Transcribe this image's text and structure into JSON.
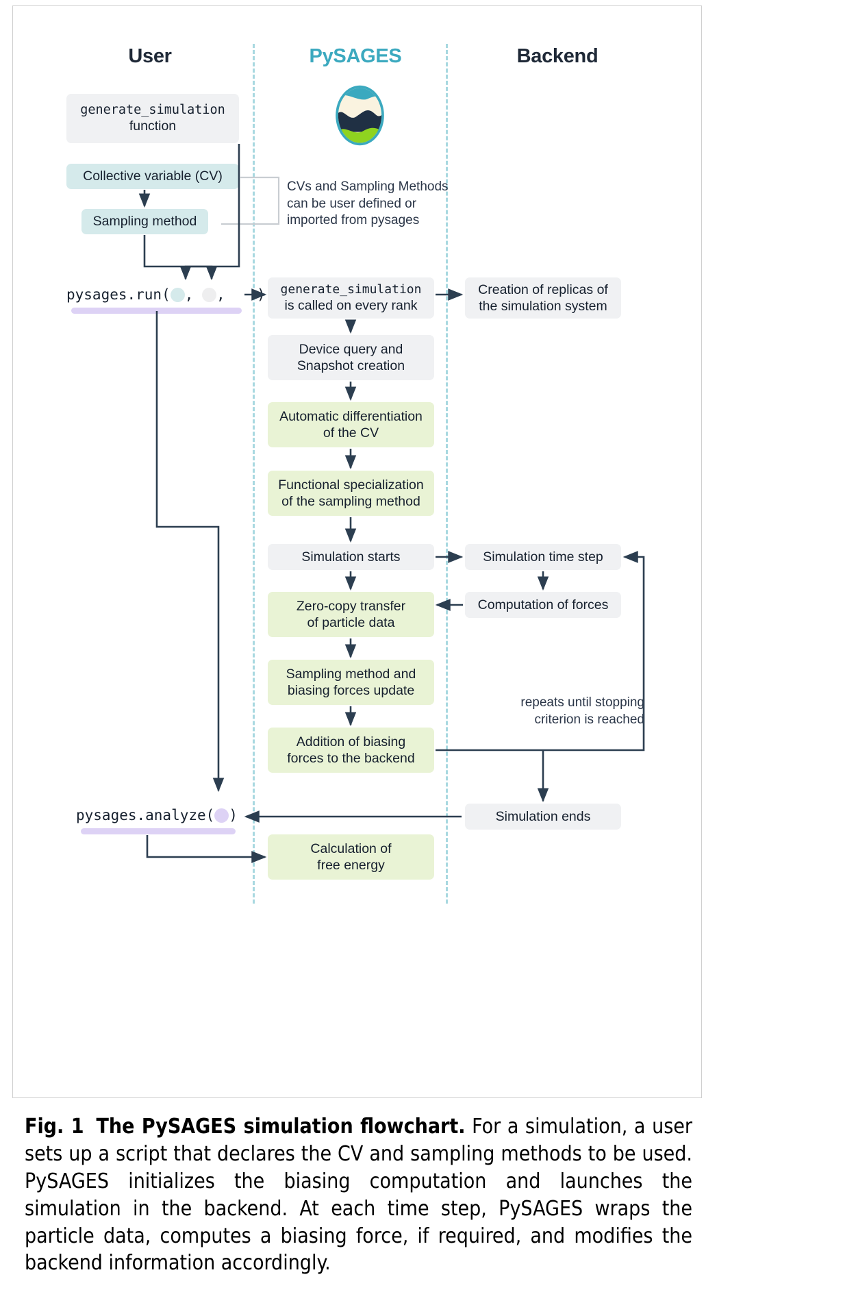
{
  "figure": {
    "columns": [
      {
        "id": "user",
        "label": "User"
      },
      {
        "id": "pysages",
        "label": "PySAGES"
      },
      {
        "id": "backend",
        "label": "Backend"
      }
    ],
    "logo": {
      "name": "pysages-logo",
      "ring_color": "#3ba9bf",
      "cream_color": "#faf3e0",
      "wave_color": "#203044",
      "green_color": "#8fd320"
    },
    "colors": {
      "gray_box": "#f0f1f3",
      "teal_box": "#d5eaeb",
      "green_box": "#e9f3d5",
      "lavender": "#ddd2f5",
      "lane_divider": "#a8d8e0",
      "arrow": "#2c3e50",
      "pysages_accent": "#3ba9bf"
    },
    "user_column": {
      "generate_simulation_box": {
        "line1": "generate_simulation",
        "line2": "function"
      },
      "cv_box": "Collective variable (CV)",
      "sampling_box": "Sampling method",
      "run_call": {
        "prefix": "pysages.run(",
        "sep1": ", ",
        "sep2": ",  ",
        "suffix": ")"
      },
      "analyze_call": {
        "prefix": "pysages.analyze(",
        "suffix": ")"
      }
    },
    "annotations": {
      "cv_note": "CVs and Sampling Methods can be user defined or imported from pysages",
      "repeat_note": "repeats until stopping criterion is reached"
    },
    "pysages_column": [
      {
        "id": "generate-sim-rank",
        "line1": "generate_simulation",
        "line2": "is called on every rank",
        "style": "gray",
        "mono_line1": true
      },
      {
        "id": "device-query",
        "line1": "Device query and",
        "line2": "Snapshot creation",
        "style": "gray"
      },
      {
        "id": "auto-diff",
        "line1": "Automatic differentiation",
        "line2": "of the CV",
        "style": "green"
      },
      {
        "id": "functional-spec",
        "line1": "Functional specialization",
        "line2": "of the sampling method",
        "style": "green"
      },
      {
        "id": "simulation-starts",
        "line1": "Simulation starts",
        "line2": "",
        "style": "gray"
      },
      {
        "id": "zero-copy",
        "line1": "Zero-copy transfer",
        "line2": "of particle data",
        "style": "green"
      },
      {
        "id": "sampling-update",
        "line1": "Sampling method and",
        "line2": "biasing forces update",
        "style": "green"
      },
      {
        "id": "addition-biasing",
        "line1": "Addition of biasing",
        "line2": "forces to the backend",
        "style": "green"
      },
      {
        "id": "free-energy",
        "line1": "Calculation of",
        "line2": "free energy",
        "style": "green"
      }
    ],
    "backend_column": [
      {
        "id": "creation-replicas",
        "line1": "Creation of replicas of",
        "line2": "the simulation system",
        "style": "gray"
      },
      {
        "id": "simulation-timestep",
        "line1": "Simulation time step",
        "line2": "",
        "style": "gray"
      },
      {
        "id": "computation-forces",
        "line1": "Computation of forces",
        "line2": "",
        "style": "gray"
      },
      {
        "id": "simulation-ends",
        "line1": "Simulation ends",
        "line2": "",
        "style": "gray"
      }
    ]
  },
  "caption": {
    "label": "Fig. 1",
    "title": "The PySAGES simulation flowchart.",
    "body": "For a simulation, a user sets up a script that declares the CV and sampling methods to be used. PySAGES initializes the biasing computation and launches the simulation in the backend. At each time step, PySAGES wraps the particle data, computes a biasing force, if required, and modifies the backend information accordingly."
  }
}
